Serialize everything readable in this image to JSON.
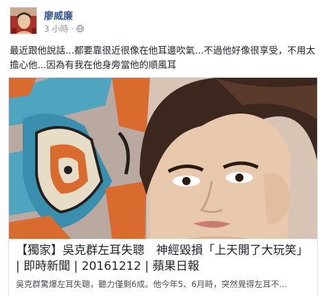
{
  "post": {
    "author": "廖威廉",
    "timestamp": "3 小時",
    "separator": "·",
    "privacy_icon": "globe-icon",
    "text": "最近跟他說話...都要靠很近很像在他耳邊吹氣...不過他好像很享受，不用太擔心他...因為有我在他身旁當他的順風耳"
  },
  "link_card": {
    "title": "【獨家】吳克群左耳失聰　神經毀損「上天開了大玩笑」 | 即時新聞 | 20161212 | 蘋果日報",
    "snippet": "吳克群驚爆左耳失聰，聽力僅剩6成。他今年5、6月時，突然覺得左耳不..."
  },
  "colors": {
    "name_link": "#365899",
    "meta_gray": "#90949c",
    "text": "#1d2129"
  }
}
